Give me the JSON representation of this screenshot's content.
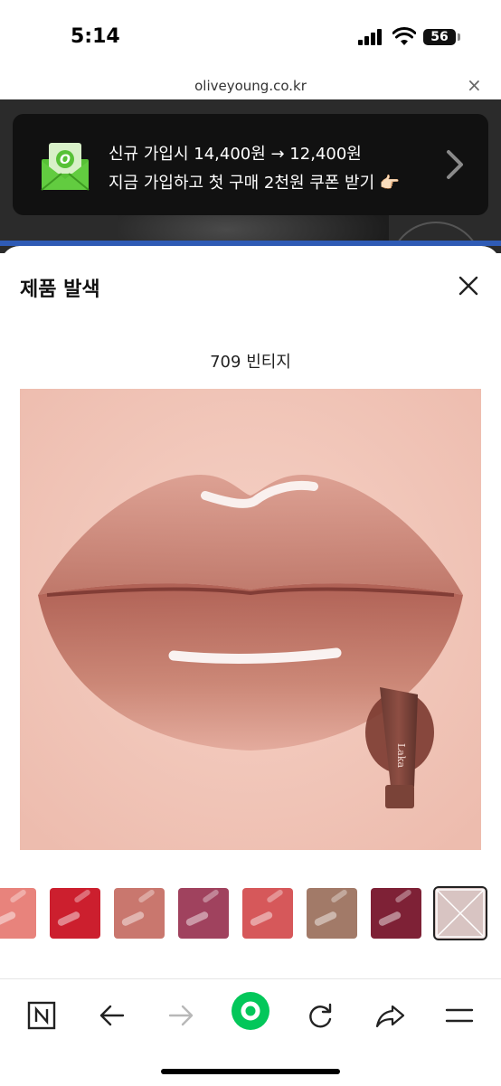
{
  "status_bar": {
    "time": "5:14",
    "battery": "56"
  },
  "browser": {
    "url": "oliveyoung.co.kr",
    "close_symbol": "×"
  },
  "promo_banner": {
    "line1": "신규 가입시 14,400원 → 12,400원",
    "line2": "지금 가입하고 첫 구매 2천원 쿠폰 받기 👉🏻",
    "icon": "envelope-coupon-icon",
    "accent": "#57c136"
  },
  "sheet": {
    "title": "제품 발색",
    "shade_name": "709 빈티지",
    "product_brand": "Laka"
  },
  "swatches": [
    {
      "color": "#e8837c",
      "selected": false
    },
    {
      "color": "#cc1f2e",
      "selected": false
    },
    {
      "color": "#c9776e",
      "selected": false
    },
    {
      "color": "#a0425e",
      "selected": false
    },
    {
      "color": "#d6585a",
      "selected": false
    },
    {
      "color": "#a27a68",
      "selected": false
    },
    {
      "color": "#7e2136",
      "selected": false
    },
    {
      "color": "#d8c4c2",
      "selected": true
    }
  ],
  "toolbar": {
    "items": [
      "naver-logo-icon",
      "back-arrow-icon",
      "forward-arrow-icon",
      "home-circle-icon",
      "reload-icon",
      "share-icon",
      "menu-icon"
    ],
    "accent": "#03c75a"
  }
}
